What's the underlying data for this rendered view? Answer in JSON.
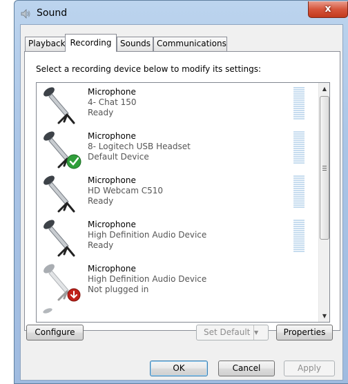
{
  "window": {
    "title": "Sound",
    "close_glyph": "x"
  },
  "tabs": [
    {
      "label": "Playback",
      "active": false
    },
    {
      "label": "Recording",
      "active": true
    },
    {
      "label": "Sounds",
      "active": false
    },
    {
      "label": "Communications",
      "active": false
    }
  ],
  "instruction": "Select a recording device below to modify its settings:",
  "devices": [
    {
      "name": "Microphone",
      "description": "4- Chat 150",
      "status": "Ready",
      "badge": "none"
    },
    {
      "name": "Microphone",
      "description": "8- Logitech USB Headset",
      "status": "Default Device",
      "badge": "default-check"
    },
    {
      "name": "Microphone",
      "description": "HD Webcam C510",
      "status": "Ready",
      "badge": "none"
    },
    {
      "name": "Microphone",
      "description": "High Definition Audio Device",
      "status": "Ready",
      "badge": "none"
    },
    {
      "name": "Microphone",
      "description": "High Definition Audio Device",
      "status": "Not plugged in",
      "badge": "unplugged"
    }
  ],
  "buttons": {
    "configure": "Configure",
    "set_default": "Set Default",
    "properties": "Properties",
    "ok": "OK",
    "cancel": "Cancel",
    "apply": "Apply"
  },
  "colors": {
    "default_badge": "#2f9e3a",
    "unplugged_badge": "#c0211a",
    "meter": "#c6dcef"
  }
}
